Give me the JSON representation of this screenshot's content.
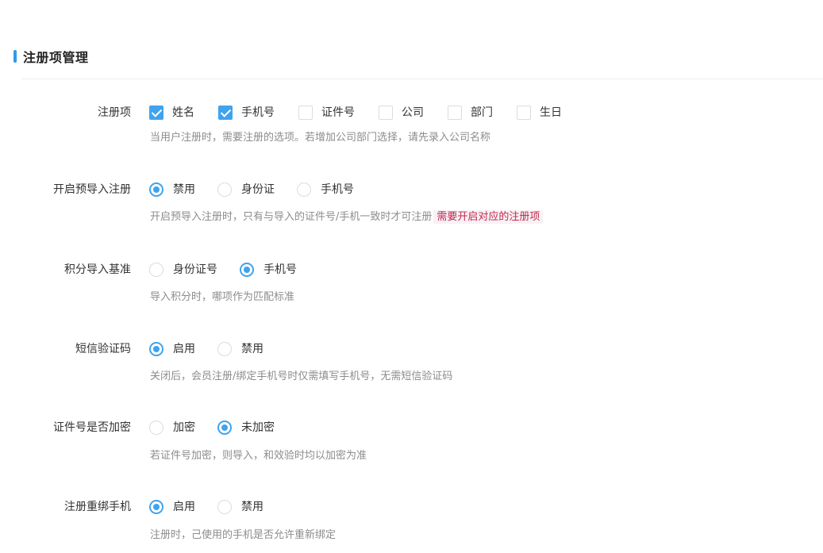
{
  "section": {
    "title": "注册项管理",
    "accent": "#2f9bea"
  },
  "reg_items": {
    "label": "注册项",
    "options": [
      {
        "label": "姓名",
        "checked": true
      },
      {
        "label": "手机号",
        "checked": true
      },
      {
        "label": "证件号",
        "checked": false
      },
      {
        "label": "公司",
        "checked": false
      },
      {
        "label": "部门",
        "checked": false
      },
      {
        "label": "生日",
        "checked": false
      }
    ],
    "hint": "当用户注册时，需要注册的选项。若增加公司部门选择，请先录入公司名称"
  },
  "pre_import": {
    "label": "开启预导入注册",
    "options": [
      {
        "label": "禁用",
        "selected": true
      },
      {
        "label": "身份证",
        "selected": false
      },
      {
        "label": "手机号",
        "selected": false
      }
    ],
    "hint": "开启预导入注册时，只有与导入的证件号/手机一致时才可注册",
    "hint_highlight": "需要开启对应的注册项"
  },
  "points_basis": {
    "label": "积分导入基准",
    "options": [
      {
        "label": "身份证号",
        "selected": false
      },
      {
        "label": "手机号",
        "selected": true
      }
    ],
    "hint": "导入积分时，哪项作为匹配标准"
  },
  "sms_code": {
    "label": "短信验证码",
    "options": [
      {
        "label": "启用",
        "selected": true
      },
      {
        "label": "禁用",
        "selected": false
      }
    ],
    "hint": "关闭后，会员注册/绑定手机号时仅需填写手机号，无需短信验证码"
  },
  "id_encrypt": {
    "label": "证件号是否加密",
    "options": [
      {
        "label": "加密",
        "selected": false
      },
      {
        "label": "未加密",
        "selected": true
      }
    ],
    "hint": "若证件号加密，则导入，和效验时均以加密为准"
  },
  "rebind_phone": {
    "label": "注册重绑手机",
    "options": [
      {
        "label": "启用",
        "selected": true
      },
      {
        "label": "禁用",
        "selected": false
      }
    ],
    "hint": "注册时，己使用的手机是否允许重新绑定"
  },
  "colors": {
    "accent": "#3fa3ee",
    "hint_text": "#8c8c8c",
    "code_highlight": "#c7254e"
  }
}
